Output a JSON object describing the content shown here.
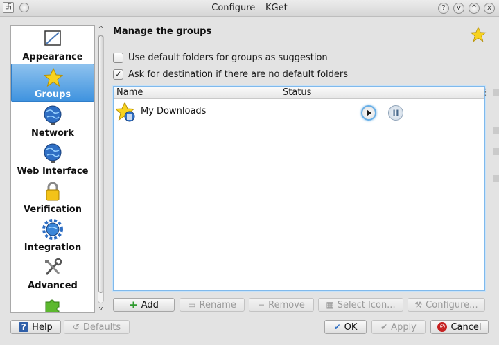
{
  "window": {
    "title": "Configure – KGet",
    "menu_glyph": "卐",
    "help_btn": "?",
    "min_btn": "v",
    "max_btn": "^",
    "close_btn": "x"
  },
  "sidebar": {
    "items": [
      {
        "label": "Appearance",
        "icon": "appearance-icon"
      },
      {
        "label": "Groups",
        "icon": "star-icon",
        "selected": true
      },
      {
        "label": "Network",
        "icon": "globe-icon"
      },
      {
        "label": "Web Interface",
        "icon": "globe-icon"
      },
      {
        "label": "Verification",
        "icon": "lock-icon"
      },
      {
        "label": "Integration",
        "icon": "gear-globe-icon"
      },
      {
        "label": "Advanced",
        "icon": "tools-icon"
      },
      {
        "label": "",
        "icon": "puzzle-icon"
      }
    ],
    "scroll_up": "^",
    "scroll_down": "v"
  },
  "main": {
    "title": "Manage the groups",
    "options": [
      {
        "label": "Use default folders for groups as suggestion",
        "checked": false
      },
      {
        "label": "Ask for destination if there are no default folders",
        "checked": true
      }
    ],
    "check_mark": "✓",
    "columns": [
      "Name",
      "Status"
    ],
    "rows": [
      {
        "name": "My Downloads"
      }
    ],
    "header_more": "⋮"
  },
  "group_buttons": {
    "add": "Add",
    "rename": "Rename",
    "remove": "Remove",
    "select_icon": "Select Icon...",
    "configure": "Configure..."
  },
  "dialog_buttons": {
    "help": "Help",
    "defaults": "Defaults",
    "ok": "OK",
    "apply": "Apply",
    "cancel": "Cancel"
  },
  "colors": {
    "selection": "#3f93df",
    "accent_border": "#7fb9ec",
    "star": "#f7d21e"
  }
}
